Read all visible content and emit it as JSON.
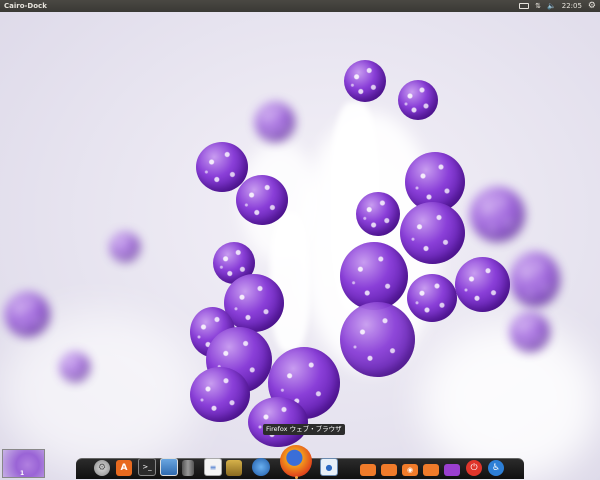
{
  "panel": {
    "title": "Cairo-Dock",
    "clock": "22:05"
  },
  "tooltip": {
    "text": "Firefox ウェブ・ブラウザ"
  },
  "workspace": {
    "number": "1"
  },
  "dock": {
    "items": [
      {
        "name": "system-settings-icon"
      },
      {
        "name": "software-center-icon"
      },
      {
        "name": "terminal-icon"
      },
      {
        "name": "image-viewer-icon"
      },
      {
        "name": "trash-icon"
      },
      {
        "name": "text-editor-icon"
      },
      {
        "name": "archive-manager-icon"
      },
      {
        "name": "thunderbird-icon"
      },
      {
        "name": "firefox-icon"
      },
      {
        "name": "messaging-icon"
      },
      {
        "name": "home-folder-icon"
      },
      {
        "name": "documents-folder-icon"
      },
      {
        "name": "music-folder-icon"
      },
      {
        "name": "downloads-folder-icon"
      },
      {
        "name": "videos-folder-icon"
      },
      {
        "name": "shutdown-icon"
      },
      {
        "name": "accessibility-icon"
      }
    ]
  },
  "colors": {
    "accent": "#8a3fd8",
    "panel": "#3a3935",
    "dock": "#111111",
    "shutdown": "#e0352b",
    "folder": "#f07b2a"
  }
}
